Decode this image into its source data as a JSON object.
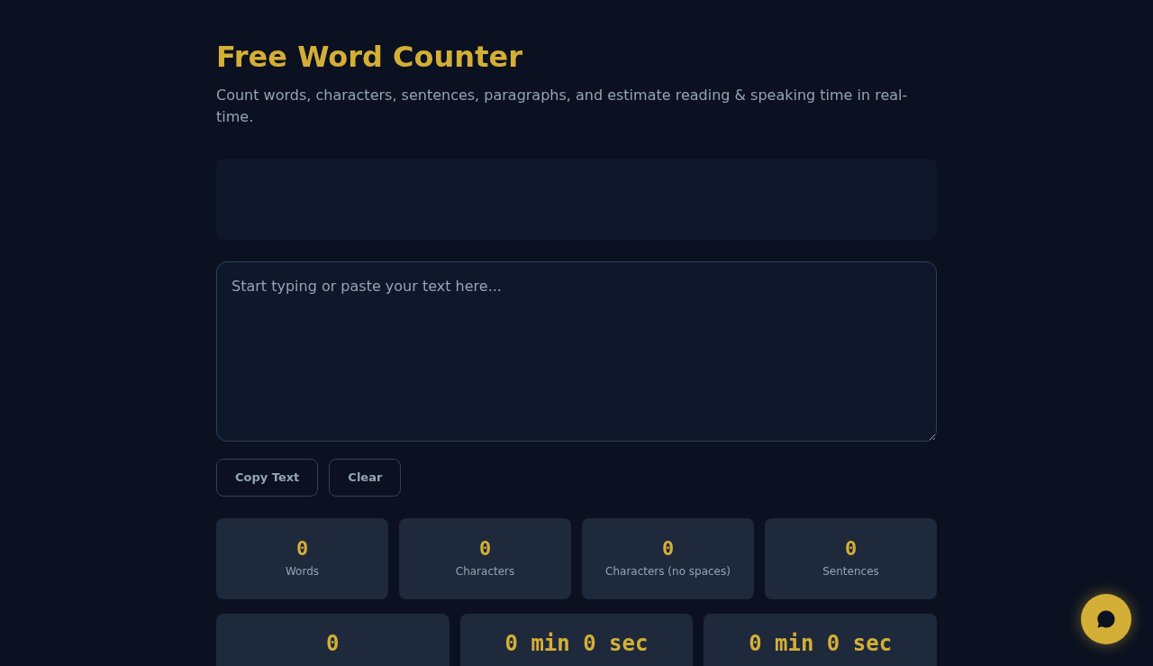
{
  "header": {
    "title": "Free Word Counter",
    "subtitle": "Count words, characters, sentences, paragraphs, and estimate reading & speaking time in real-time."
  },
  "editor": {
    "placeholder": "Start typing or paste your text here..."
  },
  "buttons": [
    "Copy Text",
    "Clear"
  ],
  "stats": [
    {
      "value": "0",
      "label": "Words"
    },
    {
      "value": "0",
      "label": "Characters"
    },
    {
      "value": "0",
      "label": "Characters (no spaces)"
    },
    {
      "value": "0",
      "label": "Sentences"
    }
  ],
  "time_stats": [
    {
      "value": "0"
    },
    {
      "value": "0 min 0 sec"
    },
    {
      "value": "0 min 0 sec"
    }
  ]
}
